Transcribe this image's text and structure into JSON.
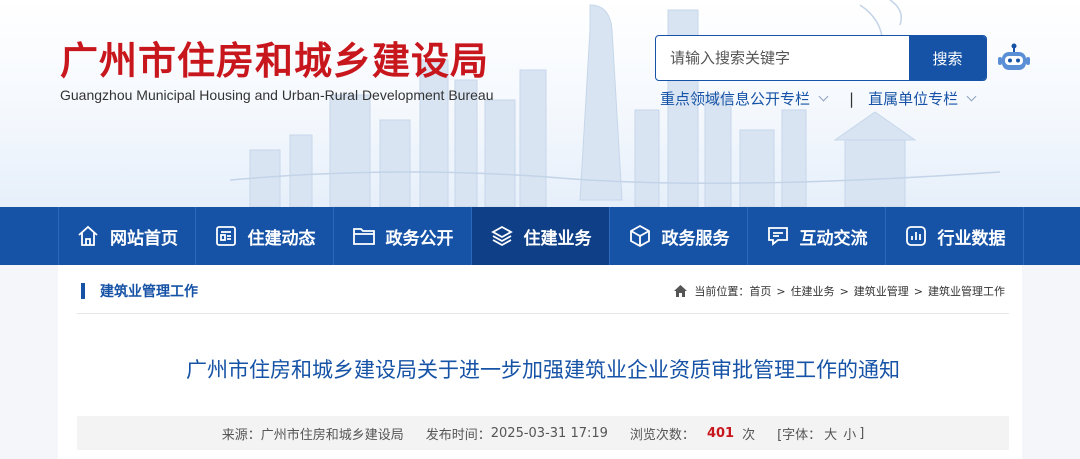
{
  "header": {
    "logo_cn": "广州市住房和城乡建设局",
    "logo_en": "Guangzhou Municipal Housing and Urban-Rural Development Bureau",
    "search": {
      "placeholder": "请输入搜索关键字",
      "button": "搜索"
    },
    "quick_links": [
      "重点领域信息公开专栏",
      "直属单位专栏"
    ],
    "quick_link_sep": "|"
  },
  "nav": {
    "items": [
      {
        "label": "网站首页",
        "icon": "home-icon"
      },
      {
        "label": "住建动态",
        "icon": "news-icon"
      },
      {
        "label": "政务公开",
        "icon": "folder-icon"
      },
      {
        "label": "住建业务",
        "icon": "layers-icon",
        "active": true
      },
      {
        "label": "政务服务",
        "icon": "cube-icon"
      },
      {
        "label": "互动交流",
        "icon": "chat-icon"
      },
      {
        "label": "行业数据",
        "icon": "chart-icon"
      }
    ]
  },
  "section": {
    "title": "建筑业管理工作"
  },
  "breadcrumb": {
    "prefix": "当前位置：",
    "items": [
      "首页",
      "住建业务",
      "建筑业管理",
      "建筑业管理工作"
    ],
    "sep": ">"
  },
  "article": {
    "title": "广州市住房和城乡建设局关于进一步加强建筑业企业资质审批管理工作的通知",
    "source_label": "来源：",
    "source": "广州市住房和城乡建设局",
    "date_label": "发布时间：",
    "date": "2025-03-31 17:19",
    "views_label": "浏览次数：",
    "views": "401",
    "views_unit": "次",
    "font_label": "[字体：",
    "font_large": "大",
    "font_small": "小",
    "font_close": "]"
  },
  "colors": {
    "brand_red": "#c8161d",
    "brand_blue": "#1653a6",
    "nav_active": "#0f3f86"
  }
}
